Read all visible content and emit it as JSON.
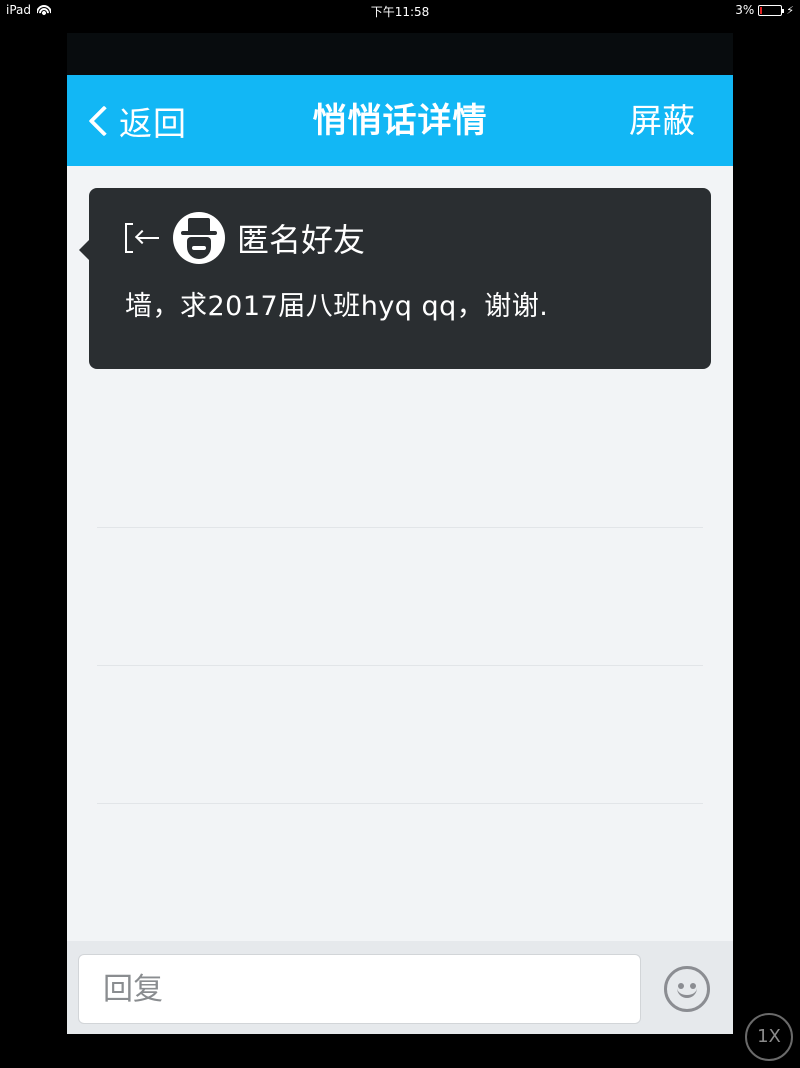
{
  "status_bar": {
    "device": "iPad",
    "time": "下午11:58",
    "battery_percent": "3%",
    "battery_level": 0.03,
    "charging_icon": "⚡"
  },
  "nav": {
    "back_label": "返回",
    "title": "悄悄话详情",
    "block_label": "屏蔽",
    "background_color": "#12b7f5"
  },
  "whisper": {
    "sender_name": "匿名好友",
    "message": "墙，求2017届八班hyq qq，谢谢.",
    "avatar_icon": "anonymous-hat-icon",
    "exit_icon": "exit-arrow-icon"
  },
  "reply": {
    "placeholder": "回复",
    "emoji_icon": "smiley-face-icon"
  },
  "zoom": {
    "label": "1X"
  }
}
